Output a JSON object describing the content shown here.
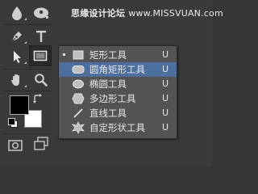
{
  "watermark": {
    "site_cn": "思缘设计论坛",
    "site_url": "www.MISSVUAN.com"
  },
  "toolbar": {
    "tools": [
      {
        "name": "blur-tool",
        "icon": "drop-icon"
      },
      {
        "name": "dodge-tool",
        "icon": "dodge-icon"
      },
      {
        "name": "pen-tool",
        "icon": "pen-icon"
      },
      {
        "name": "type-tool",
        "icon": "type-icon",
        "glyph": "T"
      },
      {
        "name": "path-selection-tool",
        "icon": "arrow-icon"
      },
      {
        "name": "shape-tool",
        "icon": "rectangle-icon",
        "active": true
      },
      {
        "name": "hand-tool",
        "icon": "hand-icon"
      },
      {
        "name": "zoom-tool",
        "icon": "magnifier-icon"
      },
      {
        "name": "quick-mask",
        "icon": "quick-mask-icon"
      },
      {
        "name": "screen-mode",
        "icon": "screen-mode-icon"
      }
    ],
    "colors": {
      "foreground": "#000000",
      "background": "#ffffff"
    }
  },
  "flyout": {
    "items": [
      {
        "label": "矩形工具",
        "shortcut": "U",
        "icon": "rectangle-icon",
        "selected": true,
        "highlighted": false
      },
      {
        "label": "圆角矩形工具",
        "shortcut": "U",
        "icon": "rounded-rectangle-icon",
        "selected": false,
        "highlighted": true
      },
      {
        "label": "椭圆工具",
        "shortcut": "U",
        "icon": "ellipse-icon",
        "selected": false,
        "highlighted": false
      },
      {
        "label": "多边形工具",
        "shortcut": "U",
        "icon": "polygon-icon",
        "selected": false,
        "highlighted": false
      },
      {
        "label": "直线工具",
        "shortcut": "U",
        "icon": "line-icon",
        "selected": false,
        "highlighted": false
      },
      {
        "label": "自定形状工具",
        "shortcut": "U",
        "icon": "custom-shape-icon",
        "selected": false,
        "highlighted": false
      }
    ],
    "highlight_color": "#4d6f9e"
  }
}
